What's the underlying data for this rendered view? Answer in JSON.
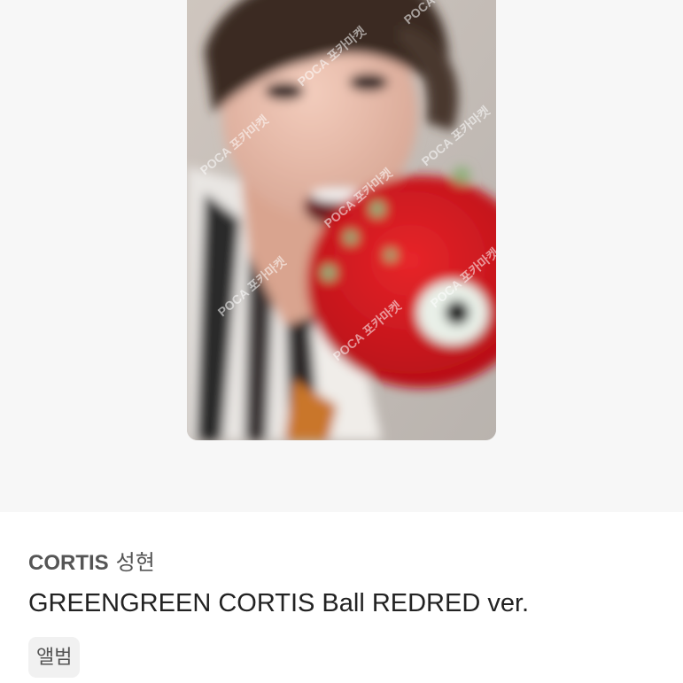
{
  "product": {
    "image_alt": "CORTIS 성현 photocard",
    "artist": "CORTIS",
    "member": "성현",
    "title": "GREENGREEN CORTIS Ball REDRED ver.",
    "category_chip": "앨범",
    "watermark_text": "POCA 포카마켓"
  },
  "colors": {
    "image_area_bg": "#f7f7f7",
    "artist_text": "#555555",
    "title_text": "#222222",
    "chip_bg": "#f1f1f1"
  }
}
